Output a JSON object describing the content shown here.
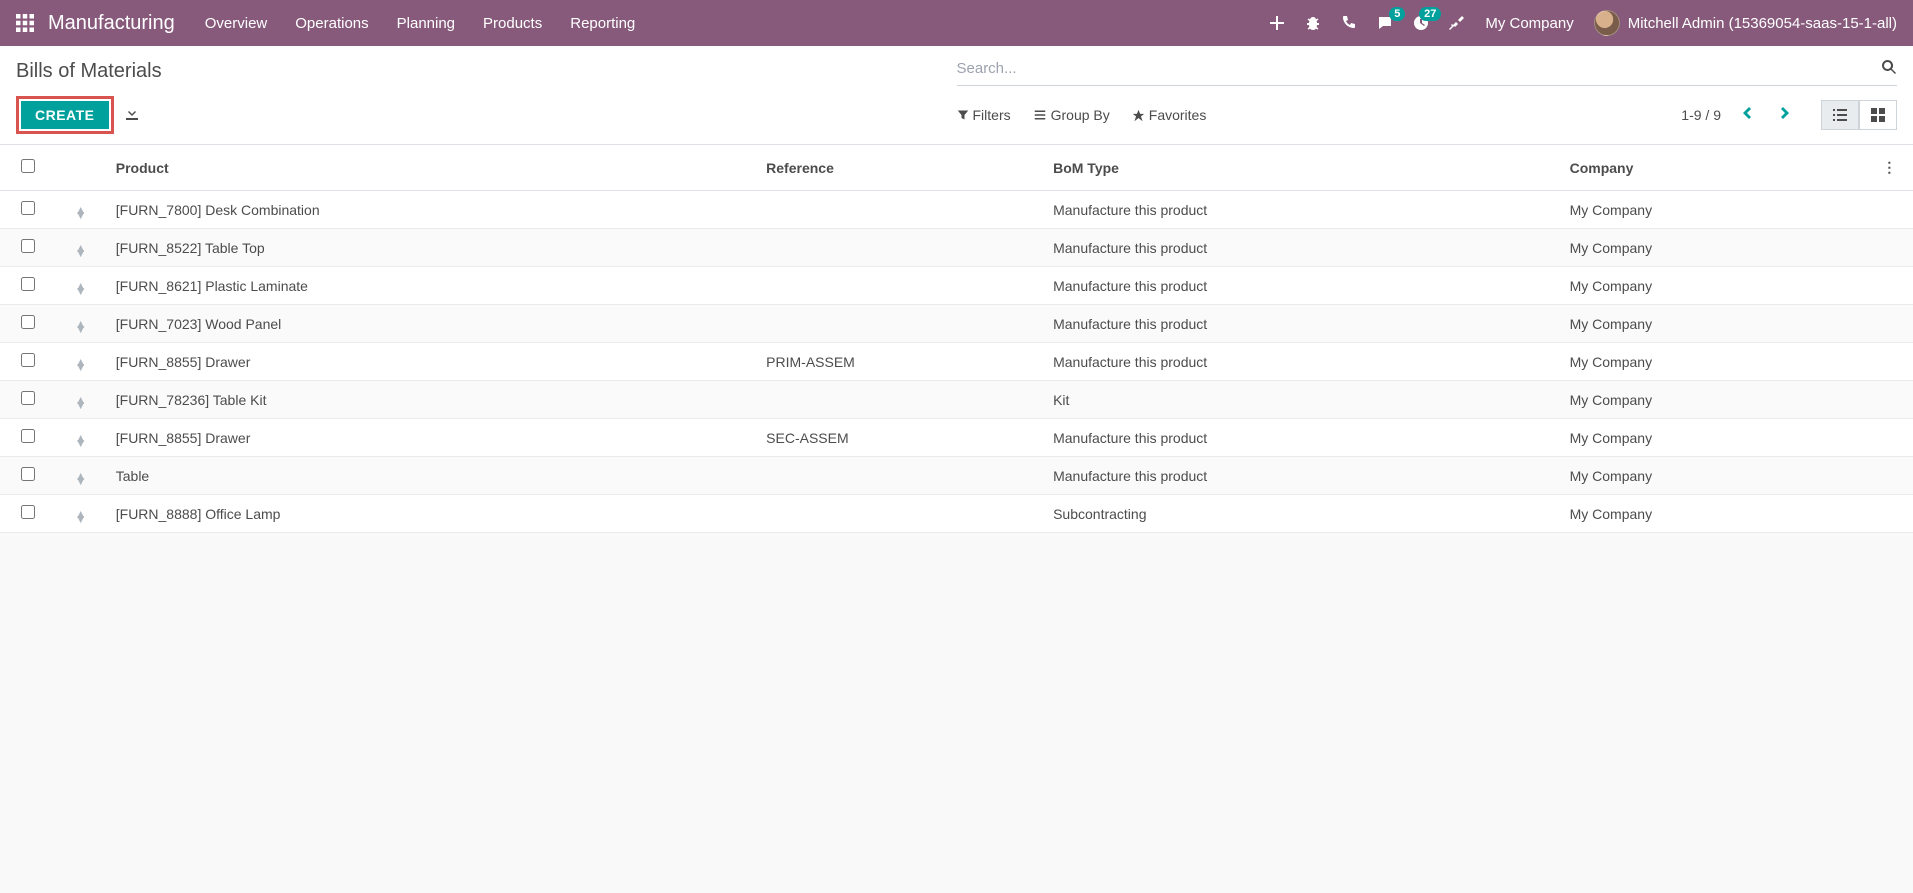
{
  "navbar": {
    "app_title": "Manufacturing",
    "menu": [
      "Overview",
      "Operations",
      "Planning",
      "Products",
      "Reporting"
    ],
    "messaging_badge": "5",
    "activities_badge": "27",
    "company": "My Company",
    "user": "Mitchell Admin (15369054-saas-15-1-all)"
  },
  "breadcrumb": "Bills of Materials",
  "search": {
    "placeholder": "Search..."
  },
  "buttons": {
    "create": "CREATE"
  },
  "filters": {
    "filters": "Filters",
    "groupby": "Group By",
    "favorites": "Favorites"
  },
  "pager": {
    "text": "1-9 / 9"
  },
  "columns": {
    "product": "Product",
    "reference": "Reference",
    "bom_type": "BoM Type",
    "company": "Company"
  },
  "rows": [
    {
      "product": "[FURN_7800] Desk Combination",
      "reference": "",
      "bom_type": "Manufacture this product",
      "company": "My Company"
    },
    {
      "product": "[FURN_8522] Table Top",
      "reference": "",
      "bom_type": "Manufacture this product",
      "company": "My Company"
    },
    {
      "product": "[FURN_8621] Plastic Laminate",
      "reference": "",
      "bom_type": "Manufacture this product",
      "company": "My Company"
    },
    {
      "product": "[FURN_7023] Wood Panel",
      "reference": "",
      "bom_type": "Manufacture this product",
      "company": "My Company"
    },
    {
      "product": "[FURN_8855] Drawer",
      "reference": "PRIM-ASSEM",
      "bom_type": "Manufacture this product",
      "company": "My Company"
    },
    {
      "product": "[FURN_78236] Table Kit",
      "reference": "",
      "bom_type": "Kit",
      "company": "My Company"
    },
    {
      "product": "[FURN_8855] Drawer",
      "reference": "SEC-ASSEM",
      "bom_type": "Manufacture this product",
      "company": "My Company"
    },
    {
      "product": "Table",
      "reference": "",
      "bom_type": "Manufacture this product",
      "company": "My Company"
    },
    {
      "product": "[FURN_8888] Office Lamp",
      "reference": "",
      "bom_type": "Subcontracting",
      "company": "My Company"
    }
  ]
}
